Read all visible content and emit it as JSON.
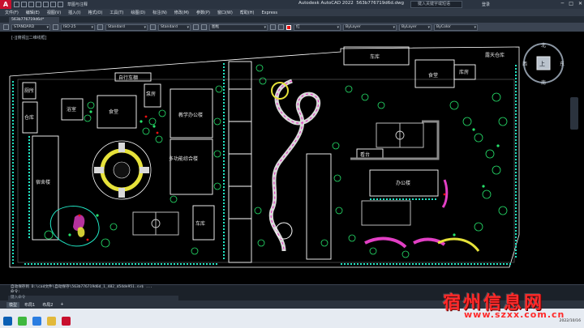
{
  "window": {
    "app_title": "Autodesk AutoCAD 2022",
    "file_name": "563b776719d6d.dwg",
    "search_placeholder": "键入关键字或短语",
    "login_label": "登录",
    "workspace": "草图与注释"
  },
  "menus": [
    "文件(F)",
    "编辑(E)",
    "视图(V)",
    "插入(I)",
    "格式(O)",
    "工具(T)",
    "绘图(D)",
    "标注(N)",
    "修改(M)",
    "参数(P)",
    "窗口(W)",
    "帮助(H)",
    "Express"
  ],
  "doc_tab": "563b776719d6d*",
  "toolbar": {
    "text_style": "STANDARD",
    "dim_style": "ISO-25",
    "table_style": "Standard",
    "mleader_style": "Standard",
    "layer_state": "图框",
    "color": "红",
    "linetype": "ByLayer",
    "lineweight": "ByLayer",
    "plotstyle": "ByColor"
  },
  "viewport_label": "[-][俯视][二维线框]",
  "compass": {
    "north": "北",
    "south": "南",
    "east": "东",
    "west": "西",
    "top": "上"
  },
  "drawing_labels": {
    "garage_ne": "车库",
    "canteen_e": "食堂",
    "storehouse": "库房",
    "open_warehouse": "露天仓库",
    "toilet": "厕所",
    "warehouse_w": "仓库",
    "dorm": "宿舍楼",
    "bath": "浴室",
    "canteen_w": "食堂",
    "class_building": "教学办公楼",
    "multi_function": "多功能综合楼",
    "garage_s": "车库",
    "stage": "看台",
    "office": "办公楼",
    "oval_label": "自行车棚",
    "pump": "泵房"
  },
  "command_history": [
    "自动保存到 D:\\cad文件\\自动保存\\563b776719d6d_1_482_d54de951.sv$ ...",
    "命令:"
  ],
  "command_placeholder": "键入命令",
  "layout_tabs": [
    "模型",
    "布局1",
    "布局2"
  ],
  "watermark": {
    "text_zh": "宿州信息网",
    "url": "www.szxx.com.cn"
  },
  "clock": {
    "date": "2022/10/16"
  },
  "colors": {
    "building_outline": "#ffffff",
    "tree_green": "#26e26b",
    "hedge_cyan": "#21e6c4",
    "accent_magenta": "#e23fc4",
    "accent_yellow": "#e6e23a",
    "watermark_red": "#ff2a2a"
  }
}
